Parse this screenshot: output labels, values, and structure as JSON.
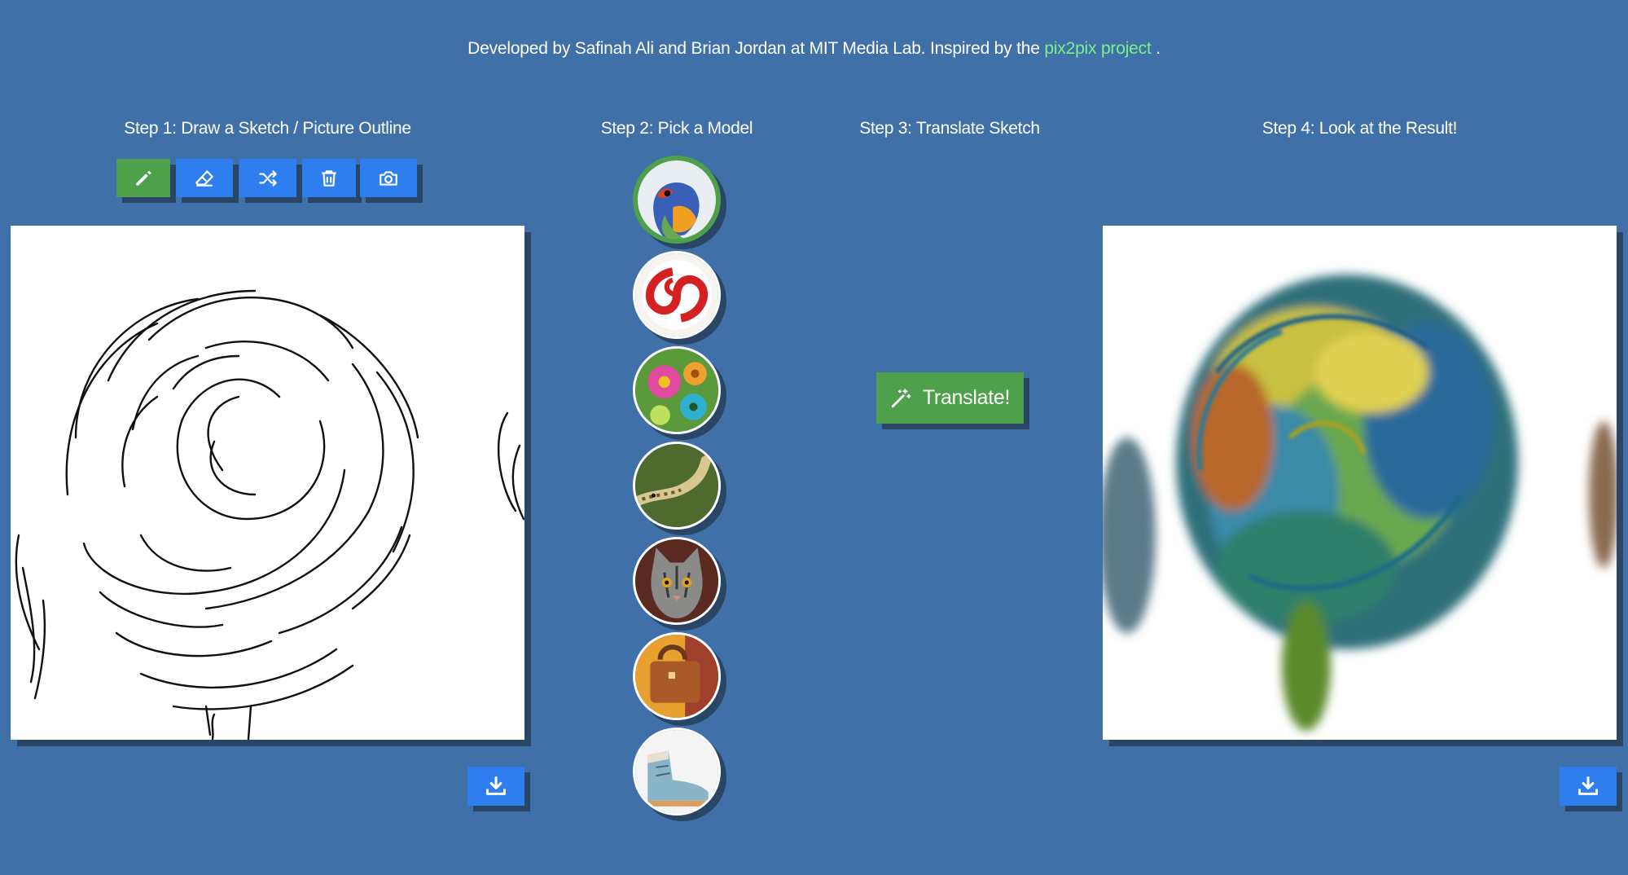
{
  "credits": {
    "prefix": "Developed by Safinah Ali and Brian Jordan at MIT Media Lab. Inspired by the",
    "link": "pix2pix project",
    "suffix": "."
  },
  "steps": {
    "step1": "Step 1: Draw a Sketch / Picture Outline",
    "step2": "Step 2: Pick a Model",
    "step3": "Step 3: Translate Sketch",
    "step4": "Step 4: Look at the Result!"
  },
  "toolbar": {
    "tools": [
      "pencil-icon",
      "eraser-icon",
      "shuffle-icon",
      "trash-icon",
      "camera-icon"
    ],
    "active_tool": "pencil-icon"
  },
  "models": {
    "items": [
      "bird",
      "candy",
      "flowers",
      "snake",
      "cat",
      "handbag",
      "shoe"
    ],
    "selected": "bird"
  },
  "translate": {
    "label": "Translate!",
    "icon": "magic-wand-icon"
  },
  "download_icon": "download-icon",
  "colors": {
    "background": "#4070a8",
    "primary_button": "#2e7ef0",
    "active_button": "#4fa04a",
    "link": "#7cf08a"
  }
}
